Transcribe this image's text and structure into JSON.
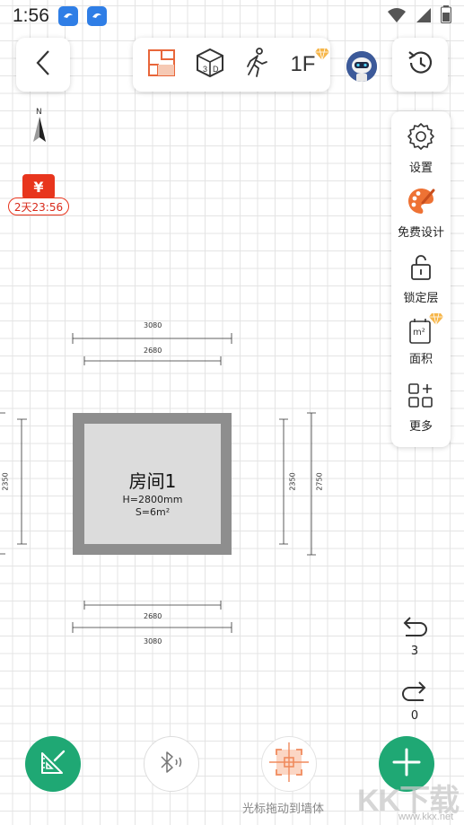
{
  "status_bar": {
    "time": "1:56"
  },
  "toolbar": {
    "floor_label": "1F"
  },
  "compass": {
    "north": "N"
  },
  "coupon": {
    "symbol": "¥",
    "timer": "2天23:56"
  },
  "side_panel": {
    "items": [
      {
        "label": "设置",
        "icon": "gear-icon"
      },
      {
        "label": "免费设计",
        "icon": "palette-icon"
      },
      {
        "label": "锁定层",
        "icon": "unlock-icon"
      },
      {
        "label": "面积",
        "icon": "area-icon",
        "area_unit": "m²"
      },
      {
        "label": "更多",
        "icon": "grid-plus-icon"
      }
    ]
  },
  "room": {
    "name": "房间1",
    "height": "H=2800mm",
    "area": "S=6m²",
    "dimensions": {
      "top_outer": "3080",
      "top_inner": "2680",
      "bottom_inner": "2680",
      "bottom_outer": "3080",
      "left": "2350",
      "right_inner": "2350",
      "right_outer": "2750"
    }
  },
  "history": {
    "undo_count": "3",
    "redo_count": "0"
  },
  "bottom": {
    "cursor_hint": "光标拖动到墙体"
  },
  "watermark": {
    "text": "KK下载",
    "sub": "www.kkx.net"
  },
  "colors": {
    "accent": "#1fa874",
    "room_fill": "#dcdcdc",
    "wall": "#8e8e8e",
    "coupon": "#e8351d",
    "cursor": "#f08a5d"
  }
}
